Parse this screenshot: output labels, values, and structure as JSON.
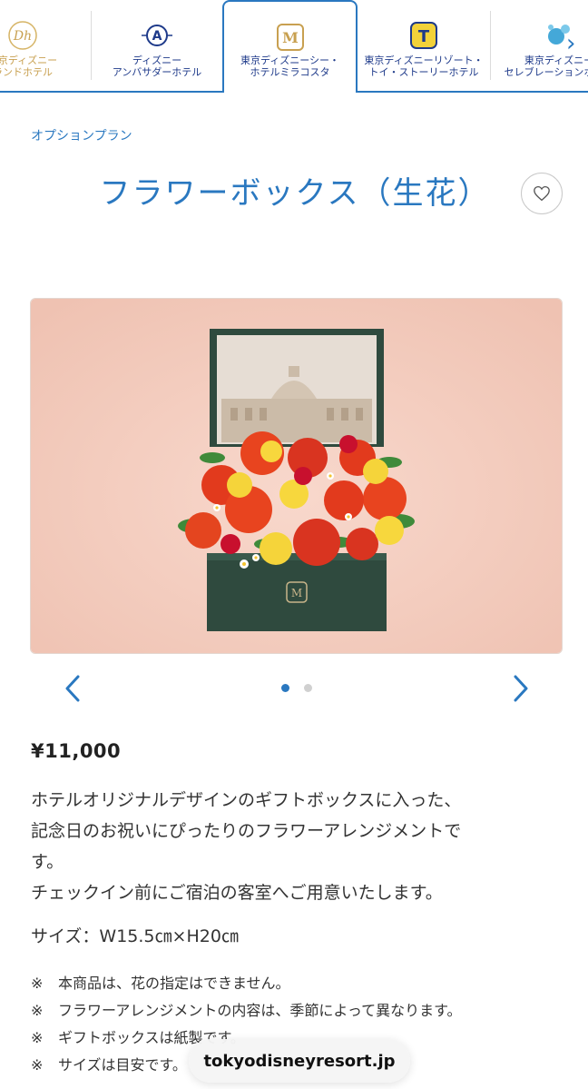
{
  "hotel_tabs": [
    {
      "label_line1": "東京ディズニー",
      "label_line2": "ランドホテル",
      "color": "#c8a050",
      "icon": "disneyland-hotel-crest-icon"
    },
    {
      "label_line1": "ディズニー",
      "label_line2": "アンバサダーホテル",
      "color": "#1e3a8a",
      "icon": "ambassador-a-badge-icon"
    },
    {
      "label_line1": "東京ディズニーシー・",
      "label_line2": "ホテルミラコスタ",
      "color": "#1e3a8a",
      "icon": "miracosta-m-badge-icon",
      "active": true
    },
    {
      "label_line1": "東京ディズニーリゾート・",
      "label_line2": "トイ・ストーリーホテル",
      "color": "#1e3a8a",
      "icon": "toy-story-t-badge-icon"
    },
    {
      "label_line1": "東京ディズニー",
      "label_line2": "セレブレーションホテル",
      "color": "#1e3a8a",
      "icon": "celebration-hotel-badge-icon"
    }
  ],
  "breadcrumb": "オプションプラン",
  "product": {
    "title": "フラワーボックス（生花）",
    "image_alt": "フラワーボックス（生花）",
    "price": "¥11,000",
    "description": [
      "ホテルオリジナルデザインのギフトボックスに入った、",
      "記念日のお祝いにぴったりのフラワーアレンジメントで",
      "す。",
      "チェックイン前にご宿泊の客室へご用意いたします。"
    ],
    "size": "サイズ：W15.5㎝×H20㎝",
    "notes": [
      {
        "mark": "※",
        "text": "本商品は、花の指定はできません。"
      },
      {
        "mark": "※",
        "text": "フラワーアレンジメントの内容は、季節によって異なります。"
      },
      {
        "mark": "※",
        "text": "ギフトボックスは紙製です。"
      },
      {
        "mark": "※",
        "text": "サイズは目安です。"
      }
    ]
  },
  "carousel": {
    "current_slide": 1,
    "total_slides": 2
  },
  "url_bar": "tokyodisneyresort.jp",
  "colors": {
    "accent": "#2a78c0",
    "dot_active": "#2a78c0",
    "dot_inactive": "#d0d0d0"
  }
}
